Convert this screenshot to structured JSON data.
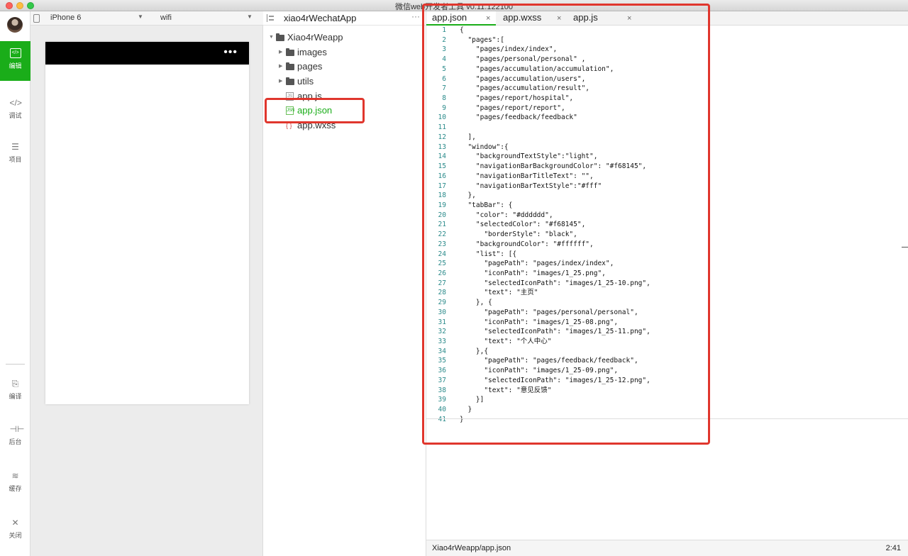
{
  "window": {
    "title": "微信web开发者工具 v0.11.122100"
  },
  "sidebar": {
    "items": [
      {
        "label": "编辑",
        "icon": "code-box-icon",
        "active": true
      },
      {
        "label": "调试",
        "icon": "debug-icon"
      },
      {
        "label": "项目",
        "icon": "list-icon"
      },
      {
        "label": "编译",
        "icon": "compile-icon"
      },
      {
        "label": "后台",
        "icon": "backend-icon"
      },
      {
        "label": "缓存",
        "icon": "cache-icon"
      },
      {
        "label": "关闭",
        "icon": "close-icon"
      }
    ]
  },
  "device": {
    "model": "iPhone 6",
    "network": "wifi"
  },
  "simulator": {
    "nav_dots": "•••",
    "nav_color": "#000000"
  },
  "explorer": {
    "title": "xiao4rWechatApp",
    "more": "···",
    "root": "Xiao4rWeapp",
    "folders": [
      "images",
      "pages",
      "utils"
    ],
    "files": [
      {
        "name": "app.js",
        "icon": "JS"
      },
      {
        "name": "app.json",
        "icon": "JSN",
        "selected": true
      },
      {
        "name": "app.wxss",
        "icon": "{ }"
      }
    ]
  },
  "editor": {
    "tabs": [
      {
        "label": "app.json",
        "close": "×",
        "active": true
      },
      {
        "label": "app.wxss",
        "close": "×"
      },
      {
        "label": "app.js",
        "close": "×"
      }
    ],
    "lines": [
      "{",
      "  \"pages\":[",
      "    \"pages/index/index\",",
      "    \"pages/personal/personal\" ,",
      "    \"pages/accumulation/accumulation\",",
      "    \"pages/accumulation/users\",",
      "    \"pages/accumulation/result\",",
      "    \"pages/report/hospital\",",
      "    \"pages/report/report\",",
      "    \"pages/feedback/feedback\"",
      "",
      "  ],",
      "  \"window\":{",
      "    \"backgroundTextStyle\":\"light\",",
      "    \"navigationBarBackgroundColor\": \"#f68145\",",
      "    \"navigationBarTitleText\": \"\",",
      "    \"navigationBarTextStyle\":\"#fff\"",
      "  },",
      "  \"tabBar\": {",
      "    \"color\": \"#dddddd\",",
      "    \"selectedColor\": \"#f68145\",",
      "      \"borderStyle\": \"black\",",
      "    \"backgroundColor\": \"#ffffff\",",
      "    \"list\": [{",
      "      \"pagePath\": \"pages/index/index\",",
      "      \"iconPath\": \"images/1_25.png\",",
      "      \"selectedIconPath\": \"images/1_25-10.png\",",
      "      \"text\": \"主页\"",
      "    }, {",
      "      \"pagePath\": \"pages/personal/personal\",",
      "      \"iconPath\": \"images/1_25-08.png\",",
      "      \"selectedIconPath\": \"images/1_25-11.png\",",
      "      \"text\": \"个人中心\"",
      "    },{",
      "      \"pagePath\": \"pages/feedback/feedback\",",
      "      \"iconPath\": \"images/1_25-09.png\",",
      "      \"selectedIconPath\": \"images/1_25-12.png\",",
      "      \"text\": \"意见反馈\"",
      "    }]",
      "  }",
      "}"
    ]
  },
  "status": {
    "path": "Xiao4rWeapp/app.json",
    "position": "2:41"
  },
  "colors": {
    "accent": "#1aad19",
    "highlight": "#e0362d"
  }
}
